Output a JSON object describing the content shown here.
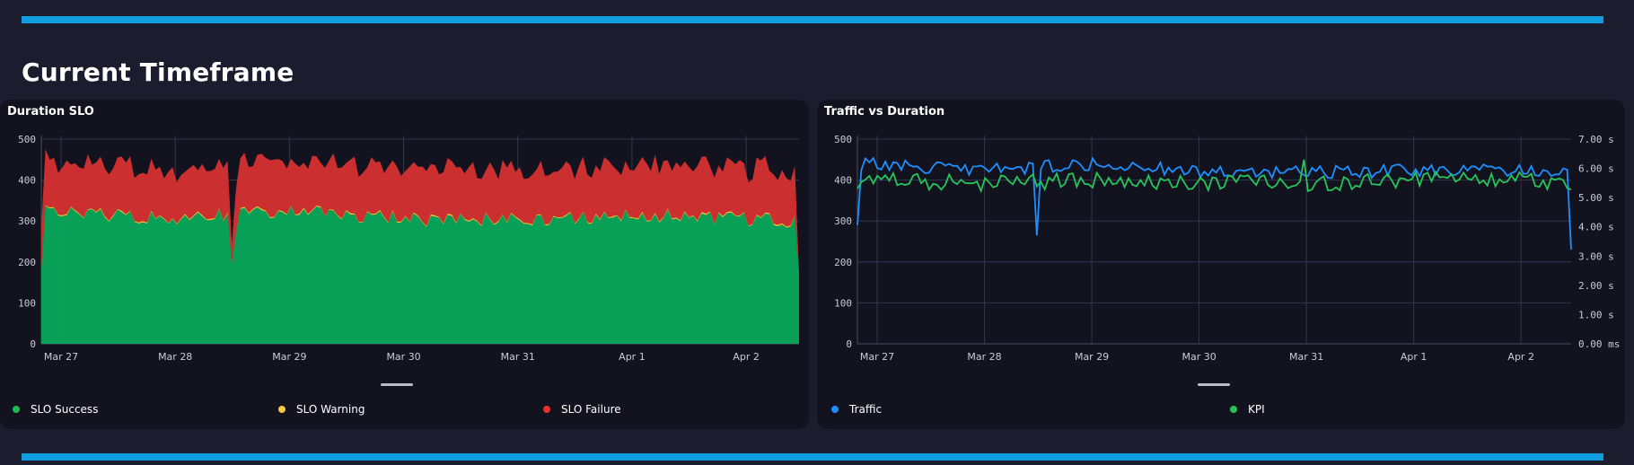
{
  "page": {
    "section_title": "Current Timeframe",
    "colors": {
      "accent": "#0f9fe0",
      "background": "#1b1d2e",
      "card": "#12131f"
    }
  },
  "tiles": {
    "duration_slo": {
      "title": "Duration SLO",
      "legend": [
        {
          "label": "SLO Success",
          "color": "#1db954"
        },
        {
          "label": "SLO Warning",
          "color": "#f5c842"
        },
        {
          "label": "SLO Failure",
          "color": "#e8322e"
        }
      ]
    },
    "traffic_vs_duration": {
      "title": "Traffic vs Duration",
      "legend": [
        {
          "label": "Traffic",
          "color": "#1e8fff"
        },
        {
          "label": "KPI",
          "color": "#27c45a"
        }
      ]
    }
  },
  "chart_data": [
    {
      "type": "area",
      "title": "Duration SLO",
      "stacked": true,
      "ylim": [
        0,
        500
      ],
      "yticks": [
        "500",
        "400",
        "300",
        "200",
        "100",
        "0"
      ],
      "xticks": [
        "Mar 27",
        "Mar 28",
        "Mar 29",
        "Mar 30",
        "Mar 31",
        "Apr 1",
        "Apr 2"
      ],
      "x": [
        "Mar 27",
        "Mar 28",
        "Mar 29",
        "Mar 30",
        "Mar 31",
        "Apr 1",
        "Apr 2"
      ],
      "series": [
        {
          "name": "SLO Success",
          "color": "#08a85a",
          "values": [
            325,
            305,
            325,
            300,
            305,
            310,
            300
          ]
        },
        {
          "name": "SLO Warning",
          "color": "#f5c842",
          "values": [
            3,
            3,
            3,
            3,
            3,
            3,
            3
          ]
        },
        {
          "name": "SLO Failure",
          "color": "#d63030",
          "values": [
            120,
            115,
            125,
            120,
            120,
            125,
            120
          ]
        }
      ],
      "grid": true,
      "legend_position": "bottom"
    },
    {
      "type": "line",
      "title": "Traffic vs Duration",
      "ylim": [
        0,
        500
      ],
      "yticks": [
        "500",
        "400",
        "300",
        "200",
        "100",
        "0"
      ],
      "y2ticks": [
        "7.00 s",
        "6.00 s",
        "5.00 s",
        "4.00 s",
        "3.00 s",
        "2.00 s",
        "1.00 s",
        "0.00 ms"
      ],
      "y2lim": [
        0,
        7
      ],
      "xticks": [
        "Mar 27",
        "Mar 28",
        "Mar 29",
        "Mar 30",
        "Mar 31",
        "Apr 1",
        "Apr 2"
      ],
      "x": [
        "Mar 27",
        "Mar 28",
        "Mar 29",
        "Mar 30",
        "Mar 31",
        "Apr 1",
        "Apr 2"
      ],
      "series": [
        {
          "name": "Traffic",
          "axis": "left",
          "color": "#1e8fff",
          "values": [
            440,
            425,
            440,
            420,
            420,
            425,
            420
          ]
        },
        {
          "name": "KPI",
          "axis": "right",
          "color": "#27c45a",
          "values": [
            5.6,
            5.5,
            5.6,
            5.5,
            5.5,
            5.7,
            5.5
          ]
        }
      ],
      "grid": true,
      "legend_position": "bottom"
    }
  ]
}
